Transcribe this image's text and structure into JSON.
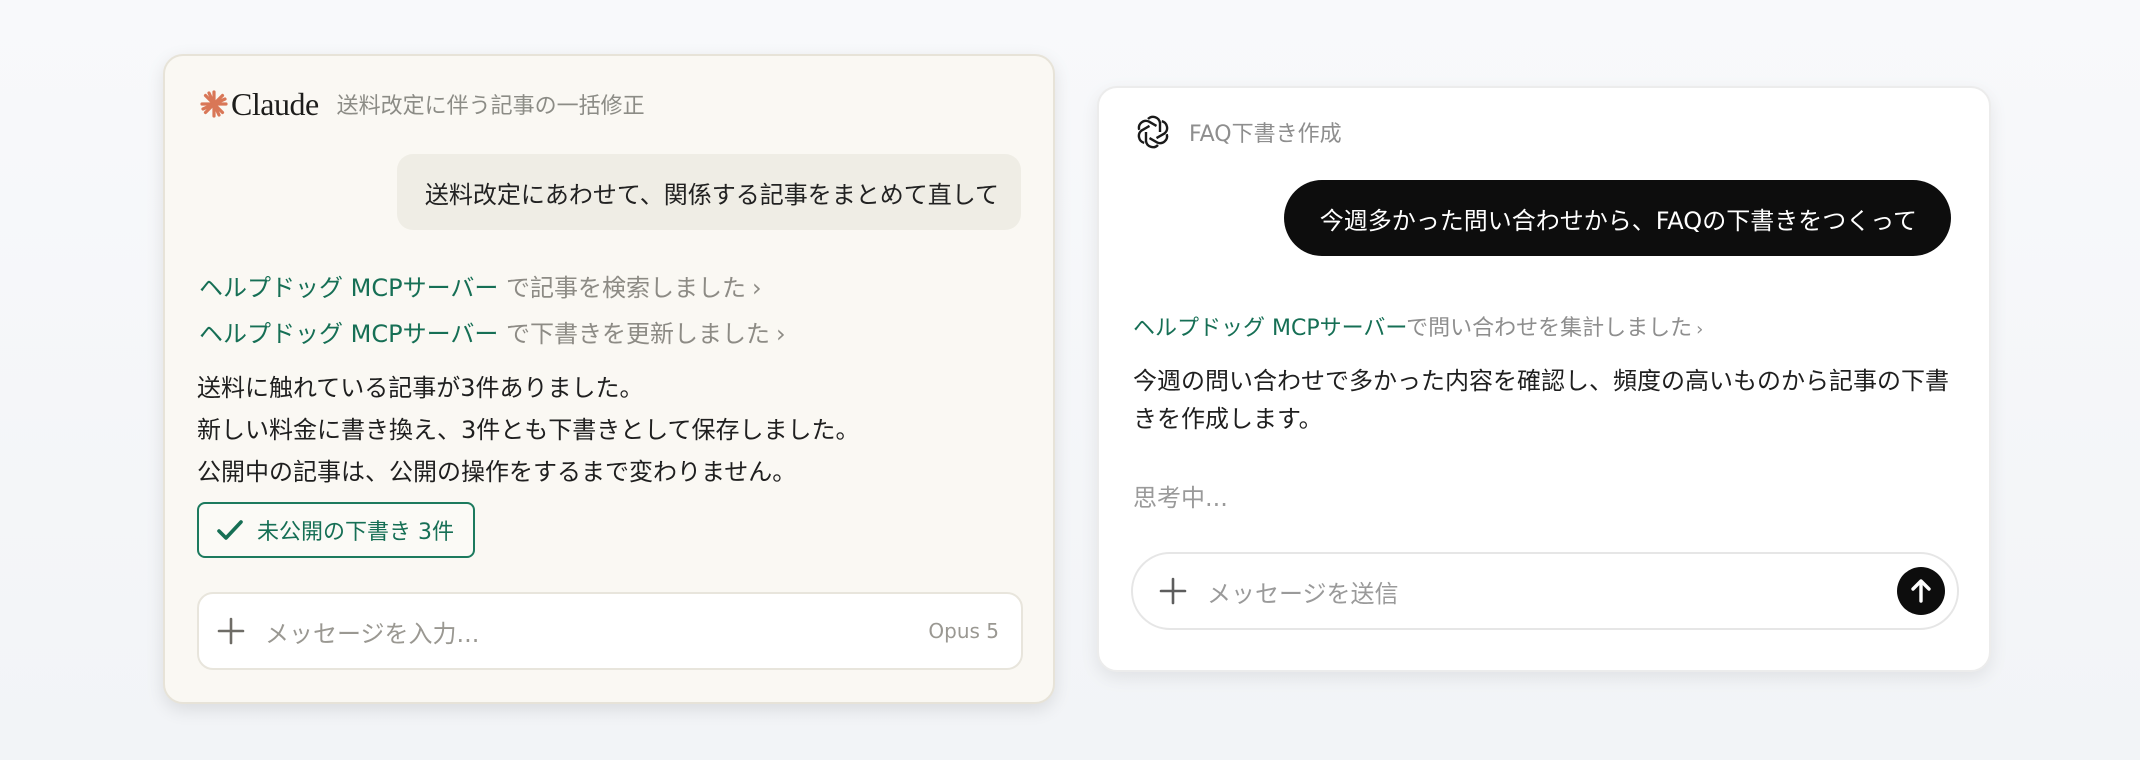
{
  "claude": {
    "brand": "Claude",
    "logo_icon": "claude-sparkle-icon",
    "chat_title": "送料改定に伴う記事の一括修正",
    "user_message": "送料改定にあわせて、関係する記事をまとめて直して",
    "tool_calls": [
      {
        "server": "ヘルプドッグ MCPサーバー",
        "action": " で記事を検索しました",
        "chevron": "›"
      },
      {
        "server": "ヘルプドッグ MCPサーバー",
        "action": " で下書きを更新しました",
        "chevron": "›"
      }
    ],
    "response_lines": [
      "送料に触れている記事が3件ありました。",
      "新しい料金に書き換え、3件とも下書きとして保存しました。",
      "公開中の記事は、公開の操作をするまで変わりません。"
    ],
    "draft_badge": {
      "label": "未公開の下書き 3件",
      "icon": "check-icon",
      "color": "#166f55"
    },
    "input": {
      "placeholder": "メッセージを入力...",
      "model": "Opus 5",
      "add_icon": "plus-icon"
    }
  },
  "chatgpt": {
    "logo_icon": "openai-logo-icon",
    "chat_title": "FAQ下書き作成",
    "user_message": "今週多かった問い合わせから、FAQの下書きをつくって",
    "tool_call": {
      "server": "ヘルプドッグ MCPサーバー",
      "action": "で問い合わせを集計しました",
      "chevron": "›"
    },
    "response": "今週の問い合わせで多かった内容を確認し、頻度の高いものから記事の下書きを作成します。",
    "thinking": "思考中...",
    "input": {
      "placeholder": "メッセージを送信",
      "add_icon": "plus-icon",
      "send_icon": "arrow-up-icon"
    }
  },
  "colors": {
    "claude_bg": "#faf8f3",
    "claude_accent": "#d97757",
    "link_green": "#166f55",
    "gpt_bubble": "#0d0d0d"
  }
}
